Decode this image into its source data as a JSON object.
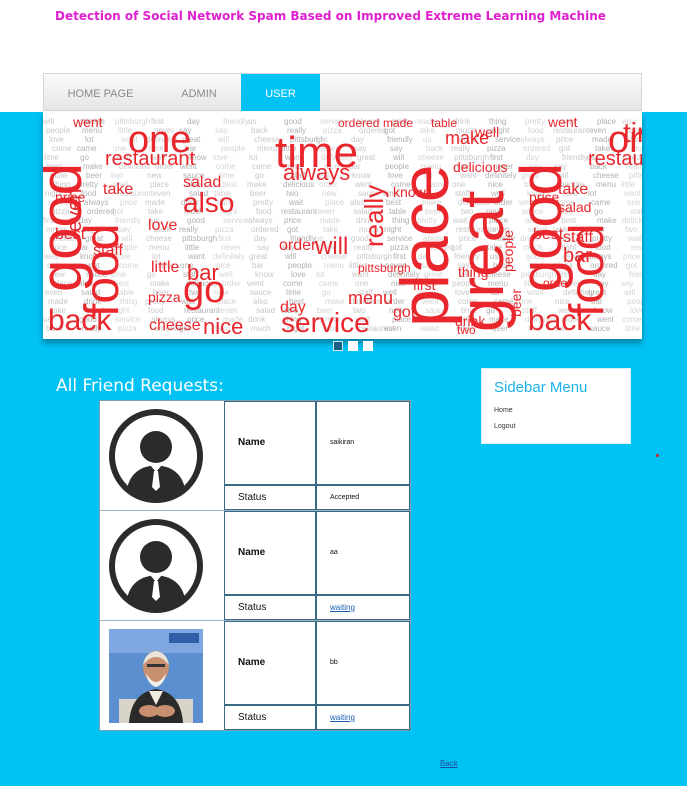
{
  "site_title": "Detection of Social Network Spam Based on Improved Extreme Learning Machine",
  "nav": {
    "items": [
      {
        "label": "HOME PAGE"
      },
      {
        "label": "ADMIN"
      },
      {
        "label": "USER"
      }
    ],
    "active": "USER"
  },
  "banner": {
    "large_words": [
      "good",
      "food",
      "place",
      "time",
      "one",
      "great",
      "back",
      "service",
      "restaurant",
      "also",
      "go",
      "nice",
      "will",
      "really",
      "always",
      "even",
      "best",
      "staff",
      "bar",
      "cheese",
      "pizza",
      "price",
      "salad",
      "make",
      "well",
      "people",
      "pittsburgh",
      "ordered",
      "made",
      "table",
      "delicious",
      "know",
      "menu",
      "first",
      "got",
      "drink",
      "beer",
      "order",
      "love",
      "little",
      "day",
      "take",
      "thing",
      "two",
      "went",
      "lot",
      "never",
      "friendly",
      "much",
      "pretty",
      "new",
      "come",
      "want",
      "say",
      "us",
      "night",
      "wait",
      "sauce",
      "came",
      "definitely",
      "say"
    ]
  },
  "slider": {
    "dots": 3,
    "active_index": 0
  },
  "requests": {
    "heading": "All Friend Requests:",
    "name_label": "Name",
    "status_label": "Status",
    "rows": [
      {
        "avatar": "default-avatar-icon",
        "name": "saikiran",
        "status": "Accepted",
        "status_is_link": false
      },
      {
        "avatar": "default-avatar-icon",
        "name": "aa",
        "status": "waiting",
        "status_is_link": true
      },
      {
        "avatar": "user-photo",
        "name": "bb",
        "status": "waiting",
        "status_is_link": true
      }
    ]
  },
  "sidebar": {
    "title": "Sidebar Menu",
    "links": [
      {
        "label": "Home"
      },
      {
        "label": "Logout"
      }
    ]
  },
  "footer": {
    "back_label": "Back"
  },
  "colors": {
    "title": "#e020d0",
    "accent": "#00c2f5",
    "wordcloud_red": "#e8262c",
    "link": "#1a5fb4"
  }
}
